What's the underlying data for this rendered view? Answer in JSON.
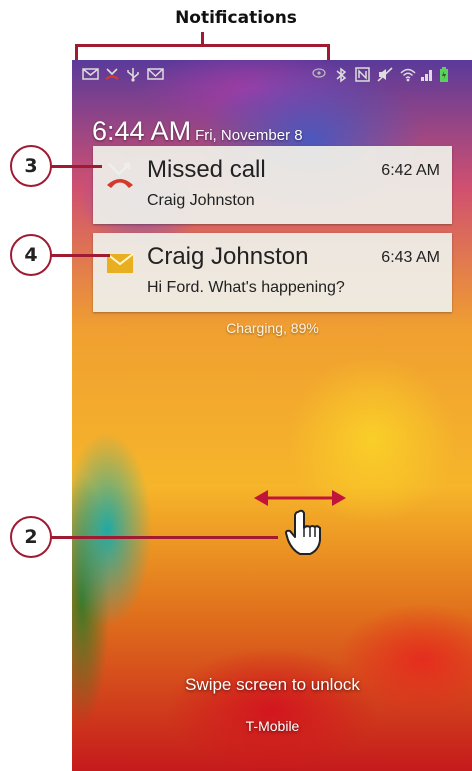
{
  "callouts": {
    "top_label": "Notifications",
    "numbers": [
      "3",
      "4",
      "2"
    ]
  },
  "lockscreen": {
    "time": "6:44 AM",
    "date": "Fri, November 8",
    "charging": "Charging, 89%",
    "unlock_hint": "Swipe screen to unlock",
    "carrier": "T-Mobile"
  },
  "notifications": [
    {
      "icon": "missed-call-icon",
      "title": "Missed call",
      "time": "6:42 AM",
      "subtitle": "Craig Johnston"
    },
    {
      "icon": "email-icon",
      "title": "Craig Johnston",
      "time": "6:43 AM",
      "subtitle": "Hi Ford. What's happening?"
    }
  ],
  "status_icons": [
    "envelope-icon",
    "missed-call-icon",
    "usb-icon",
    "gmail-icon",
    "eye-icon",
    "bluetooth-icon",
    "nfc-icon",
    "mute-icon",
    "wifi-icon",
    "signal-icon",
    "battery-icon"
  ],
  "colors": {
    "callout": "#9e1b32",
    "missed_call": "#d43a2a",
    "email": "#e8b020",
    "battery": "#5cd05c"
  }
}
